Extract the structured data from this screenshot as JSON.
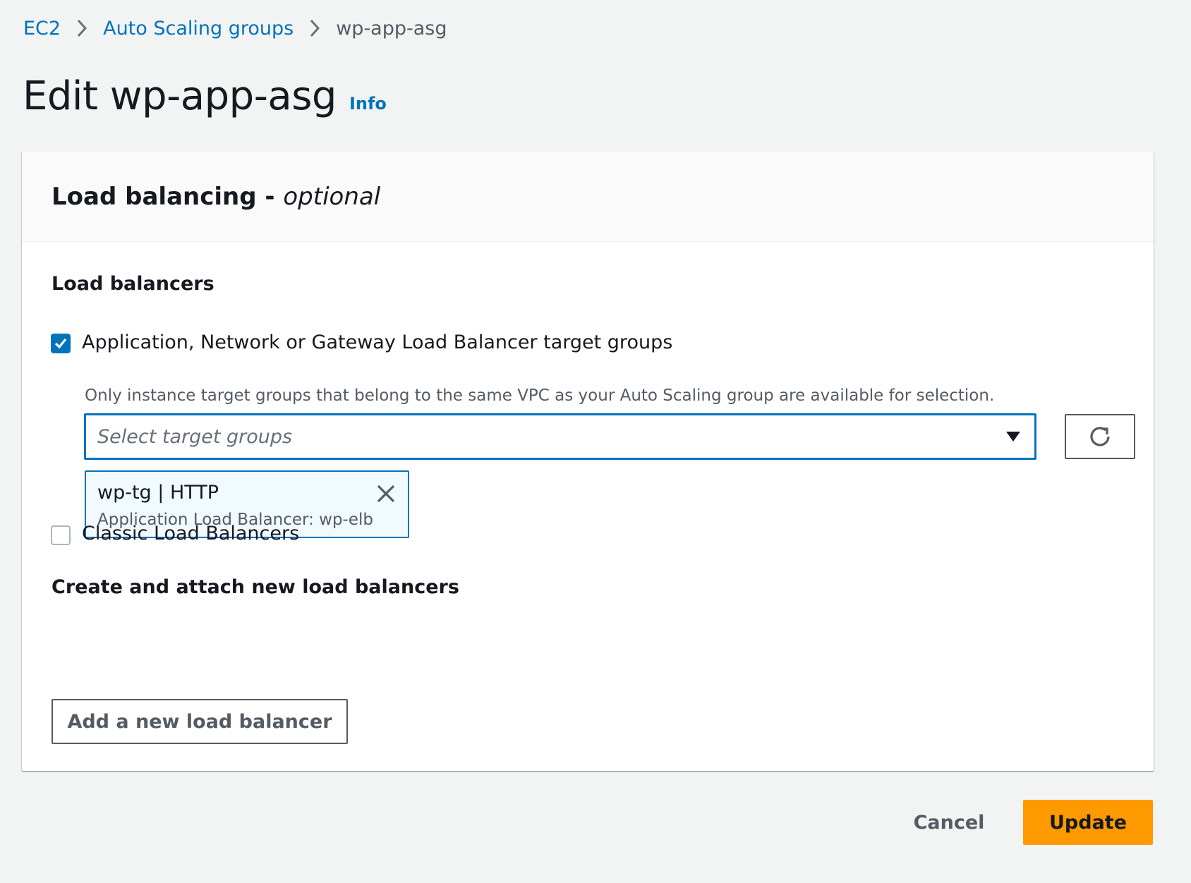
{
  "breadcrumb": {
    "items": [
      "EC2",
      "Auto Scaling groups"
    ],
    "current": "wp-app-asg"
  },
  "page": {
    "title": "Edit wp-app-asg",
    "info_label": "Info"
  },
  "panel": {
    "title": "Load balancing - ",
    "title_optional": "optional",
    "load_balancers_label": "Load balancers",
    "target_groups": {
      "checked": true,
      "label": "Application, Network or Gateway Load Balancer target groups",
      "description": "Only instance target groups that belong to the same VPC as your Auto Scaling group are available for selection.",
      "select_placeholder": "Select target groups",
      "selected_token": {
        "title": "wp-tg | HTTP",
        "subtitle": "Application Load Balancer: wp-elb"
      }
    },
    "classic": {
      "checked": false,
      "label": "Classic Load Balancers"
    },
    "create_label": "Create and attach new load balancers",
    "add_button": "Add a new load balancer"
  },
  "footer": {
    "cancel": "Cancel",
    "update": "Update"
  },
  "colors": {
    "link": "#0073bb",
    "primary": "#ff9900",
    "background": "#f2f3f3"
  },
  "icons": [
    "chevron-right-icon",
    "checkmark-icon",
    "caret-down-icon",
    "refresh-icon",
    "close-icon"
  ]
}
